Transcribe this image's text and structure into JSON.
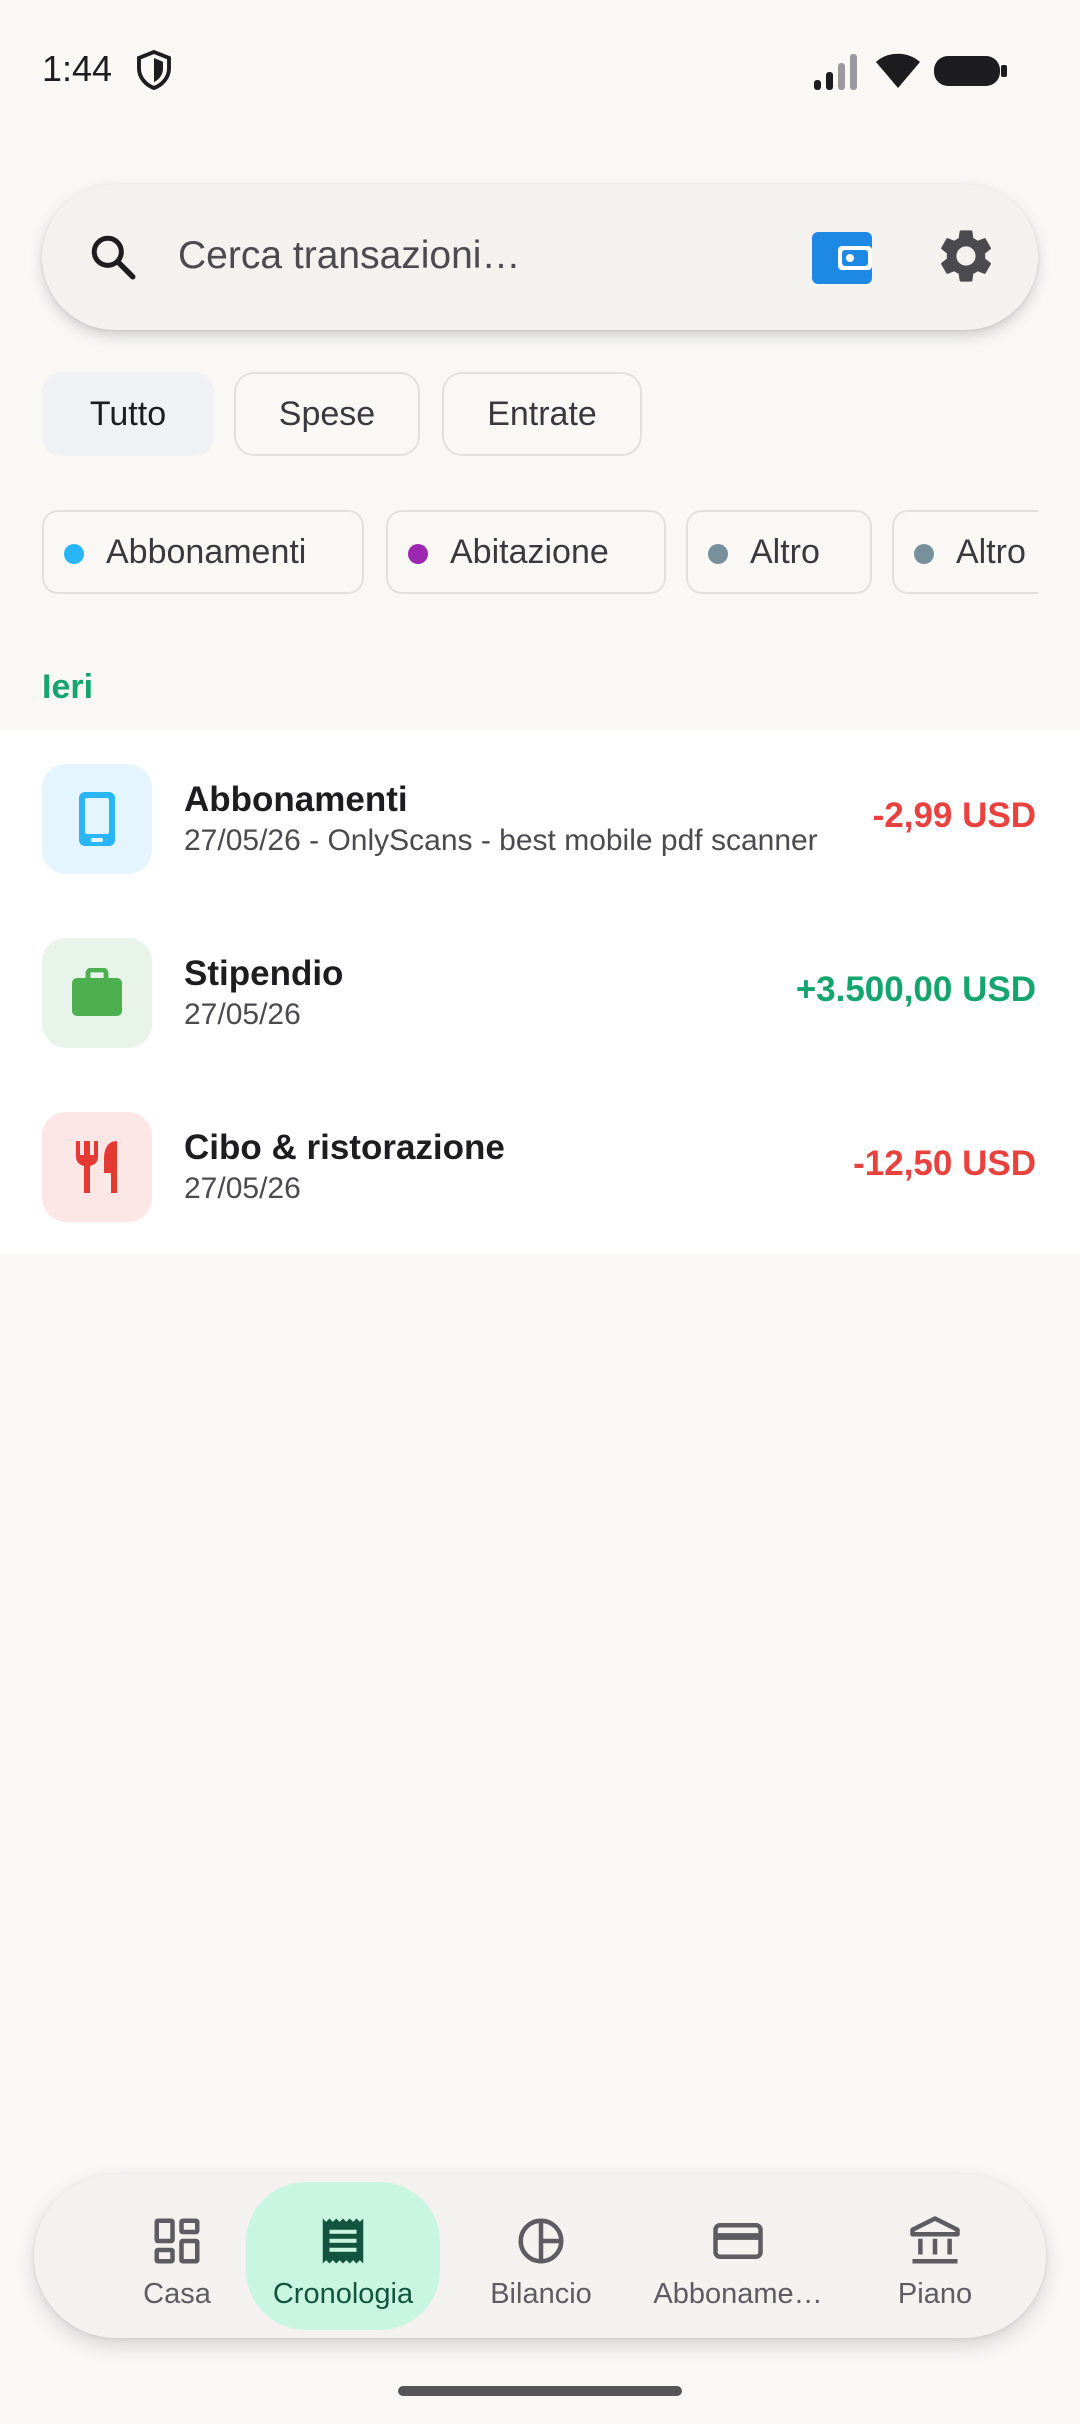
{
  "status_bar": {
    "time": "1:44"
  },
  "search": {
    "placeholder": "Cerca transazioni…"
  },
  "filters": {
    "types": [
      {
        "label": "Tutto",
        "selected": true
      },
      {
        "label": "Spese",
        "selected": false
      },
      {
        "label": "Entrate",
        "selected": false
      }
    ],
    "categories": [
      {
        "label": "Abbonamenti",
        "color": "#29b6f6"
      },
      {
        "label": "Abitazione",
        "color": "#9c27b0"
      },
      {
        "label": "Altro",
        "color": "#78909c"
      },
      {
        "label": "Altro",
        "color": "#78909c"
      }
    ]
  },
  "section": {
    "title": "Ieri"
  },
  "transactions": [
    {
      "title": "Abbonamenti",
      "subtitle": "27/05/26 - OnlyScans - best mobile pdf scanner",
      "amount": "-2,99 USD",
      "icon": "smartphone-icon",
      "icon_color": "#29b6f6",
      "icon_bg": "#e5f5fd"
    },
    {
      "title": "Stipendio",
      "subtitle": "27/05/26",
      "amount": "+3.500,00 USD",
      "icon": "briefcase-icon",
      "icon_color": "#4caf50",
      "icon_bg": "#e8f3e9"
    },
    {
      "title": "Cibo & ristorazione",
      "subtitle": "27/05/26",
      "amount": "-12,50 USD",
      "icon": "restaurant-icon",
      "icon_color": "#e53935",
      "icon_bg": "#fde6e6"
    }
  ],
  "nav": {
    "items": [
      {
        "label": "Casa",
        "icon": "dashboard-icon"
      },
      {
        "label": "Cronologia",
        "icon": "receipt-icon",
        "active": true
      },
      {
        "label": "Bilancio",
        "icon": "pie-chart-icon"
      },
      {
        "label": "Abbonamenti",
        "display_label": "Abboname…",
        "icon": "credit-card-icon"
      },
      {
        "label": "Piano",
        "icon": "bank-icon"
      }
    ]
  },
  "colors": {
    "accent_green": "#14a56e",
    "negative_red": "#e8413e",
    "wallet_blue": "#1e88e5",
    "active_nav_bg": "#c9f6e0"
  }
}
